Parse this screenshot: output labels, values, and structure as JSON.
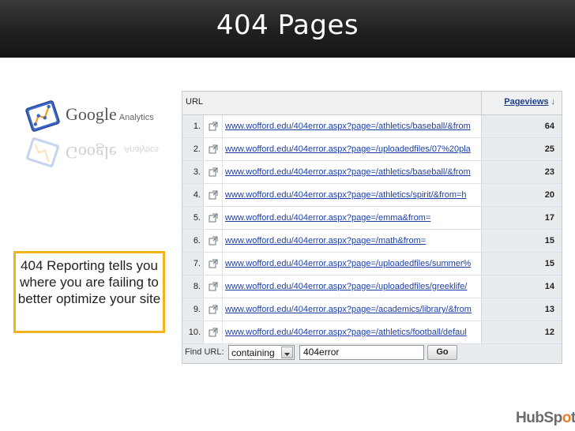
{
  "slide": {
    "title": "404 Pages"
  },
  "logo": {
    "google": "Google",
    "analytics": "Analytics"
  },
  "callout": {
    "text": "404 Reporting tells you where you are failing to better optimize your site"
  },
  "table": {
    "col_url": "URL",
    "col_pageviews": "Pageviews",
    "rows": [
      {
        "num": "1.",
        "url": "www.wofford.edu/404error.aspx?page=/athletics/baseball/&from",
        "pageviews": "64"
      },
      {
        "num": "2.",
        "url": "www.wofford.edu/404error.aspx?page=/uploadedfiles/07%20pla",
        "pageviews": "25"
      },
      {
        "num": "3.",
        "url": "www.wofford.edu/404error.aspx?page=/athletics/baseball/&from",
        "pageviews": "23"
      },
      {
        "num": "4.",
        "url": "www.wofford.edu/404error.aspx?page=/athletics/spirit/&from=h",
        "pageviews": "20"
      },
      {
        "num": "5.",
        "url": "www.wofford.edu/404error.aspx?page=/emma&from=",
        "pageviews": "17"
      },
      {
        "num": "6.",
        "url": "www.wofford.edu/404error.aspx?page=/math&from=",
        "pageviews": "15"
      },
      {
        "num": "7.",
        "url": "www.wofford.edu/404error.aspx?page=/uploadedfiles/summer%",
        "pageviews": "15"
      },
      {
        "num": "8.",
        "url": "www.wofford.edu/404error.aspx?page=/uploadedfiles/greeklife/",
        "pageviews": "14"
      },
      {
        "num": "9.",
        "url": "www.wofford.edu/404error.aspx?page=/academics/library/&from",
        "pageviews": "13"
      },
      {
        "num": "10.",
        "url": "www.wofford.edu/404error.aspx?page=/athletics/football/defaul",
        "pageviews": "12"
      }
    ]
  },
  "find": {
    "label": "Find URL:",
    "match_mode": "containing",
    "query": "404error",
    "go_label": "Go"
  },
  "brand": {
    "hub": "HubSp",
    "dot": "o",
    "t": "t"
  },
  "colors": {
    "title_bar": "#202020",
    "link": "#1c3fa5",
    "callout_border": "#f4b21b",
    "hubspot_accent": "#f07c22"
  }
}
